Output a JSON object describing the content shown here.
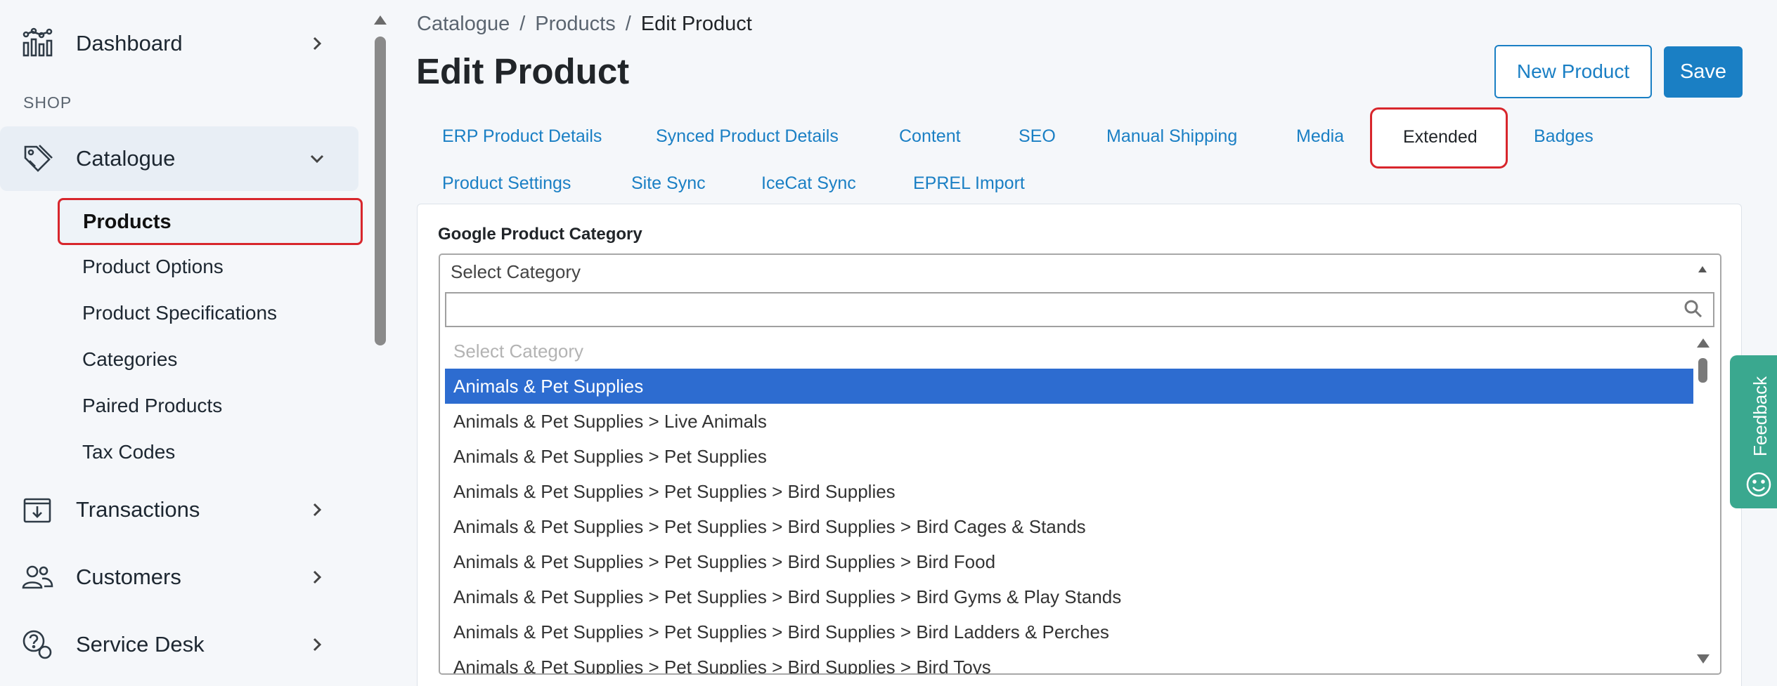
{
  "sidebar": {
    "top_items": [
      {
        "label": "Dashboard",
        "icon": "dashboard-chart-icon"
      },
      {
        "label": "Catalogue",
        "icon": "tag-icon"
      },
      {
        "label": "Transactions",
        "icon": "box-download-icon"
      },
      {
        "label": "Customers",
        "icon": "users-icon"
      },
      {
        "label": "Service Desk",
        "icon": "help-chat-icon"
      }
    ],
    "section_label": "SHOP",
    "catalogue_sub": [
      "Products",
      "Product Options",
      "Product Specifications",
      "Categories",
      "Paired Products",
      "Tax Codes"
    ]
  },
  "breadcrumb": [
    "Catalogue",
    "Products",
    "Edit Product"
  ],
  "page": {
    "title": "Edit Product",
    "new_button": "New Product",
    "save_button": "Save"
  },
  "tabs": [
    "ERP Product Details",
    "Synced Product Details",
    "Content",
    "SEO",
    "Manual Shipping",
    "Media",
    "Extended",
    "Badges",
    "Product Settings",
    "Site Sync",
    "IceCat Sync",
    "EPREL Import"
  ],
  "active_tab": "Extended",
  "form": {
    "label": "Google Product Category",
    "select_value": "Select Category",
    "search_value": "",
    "options": [
      "Select Category",
      "Animals & Pet Supplies",
      "Animals & Pet Supplies > Live Animals",
      "Animals & Pet Supplies > Pet Supplies",
      "Animals & Pet Supplies > Pet Supplies > Bird Supplies",
      "Animals & Pet Supplies > Pet Supplies > Bird Supplies > Bird Cages & Stands",
      "Animals & Pet Supplies > Pet Supplies > Bird Supplies > Bird Food",
      "Animals & Pet Supplies > Pet Supplies > Bird Supplies > Bird Gyms & Play Stands",
      "Animals & Pet Supplies > Pet Supplies > Bird Supplies > Bird Ladders & Perches",
      "Animals & Pet Supplies > Pet Supplies > Bird Supplies > Bird Toys"
    ],
    "selected_option": "Animals & Pet Supplies"
  },
  "feedback": {
    "label": "Feedback"
  },
  "colors": {
    "accent": "#1a7fc4",
    "highlight": "#2d6cd0",
    "focus_outline": "#d8262c",
    "feedback": "#3aa88f"
  }
}
